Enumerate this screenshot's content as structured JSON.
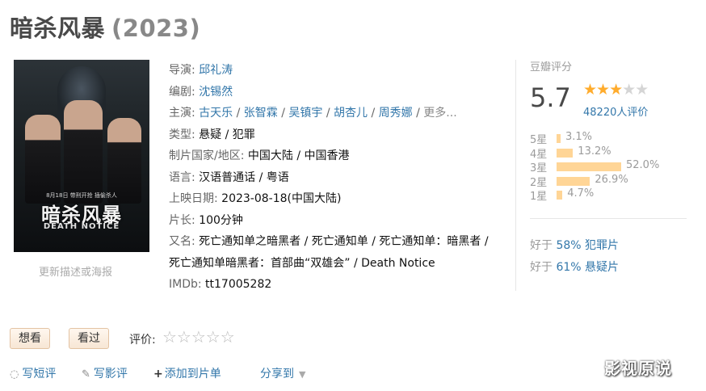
{
  "title": "暗杀风暴",
  "year": "(2023)",
  "poster": {
    "title_text": "暗杀风暴",
    "subtitle_text": "DEATH NOTICE",
    "date_text": "8月18日 带刑开抢 插偷杀人",
    "link": "更新描述或海报"
  },
  "info": {
    "director_label": "导演:",
    "director": "邱礼涛",
    "writer_label": "编剧:",
    "writer": "沈锡然",
    "cast_label": "主演:",
    "cast": [
      "古天乐",
      "张智霖",
      "吴镇宇",
      "胡杏儿",
      "周秀娜"
    ],
    "cast_more": "更多...",
    "genre_label": "类型:",
    "genre": "悬疑 / 犯罪",
    "region_label": "制片国家/地区:",
    "region": "中国大陆 / 中国香港",
    "language_label": "语言:",
    "language": "汉语普通话 / 粤语",
    "release_label": "上映日期:",
    "release": "2023-08-18(中国大陆)",
    "runtime_label": "片长:",
    "runtime": "100分钟",
    "aka_label": "又名:",
    "aka": "死亡通知单之暗黑者 / 死亡通知单 / 死亡通知单：暗黑者 / 死亡通知单暗黑者：首部曲“双雄会” / Death Notice",
    "imdb_label": "IMDb:",
    "imdb": "tt17005282"
  },
  "rating": {
    "title": "豆瓣评分",
    "score": "5.7",
    "stars_filled": 3,
    "stars_total": 5,
    "votes": "48220人评价",
    "bars": [
      {
        "label": "5星",
        "percent_text": "3.1%",
        "percent": 3.1
      },
      {
        "label": "4星",
        "percent_text": "13.2%",
        "percent": 13.2
      },
      {
        "label": "3星",
        "percent_text": "52.0%",
        "percent": 52.0
      },
      {
        "label": "2星",
        "percent_text": "26.9%",
        "percent": 26.9
      },
      {
        "label": "1星",
        "percent_text": "4.7%",
        "percent": 4.7
      }
    ],
    "bar_color": "#ffd596",
    "better_than": [
      {
        "prefix": "好于",
        "pct": "58%",
        "genre": "犯罪片"
      },
      {
        "prefix": "好于",
        "pct": "61%",
        "genre": "悬疑片"
      }
    ]
  },
  "interest": {
    "want_label": "想看",
    "seen_label": "看过",
    "rate_label": "评价:",
    "rate_stars": "☆☆☆☆☆"
  },
  "actions": {
    "short_review": "写短评",
    "review": "写影评",
    "add_list": "添加到片单",
    "share": "分享到"
  },
  "watermark": "影视原说"
}
